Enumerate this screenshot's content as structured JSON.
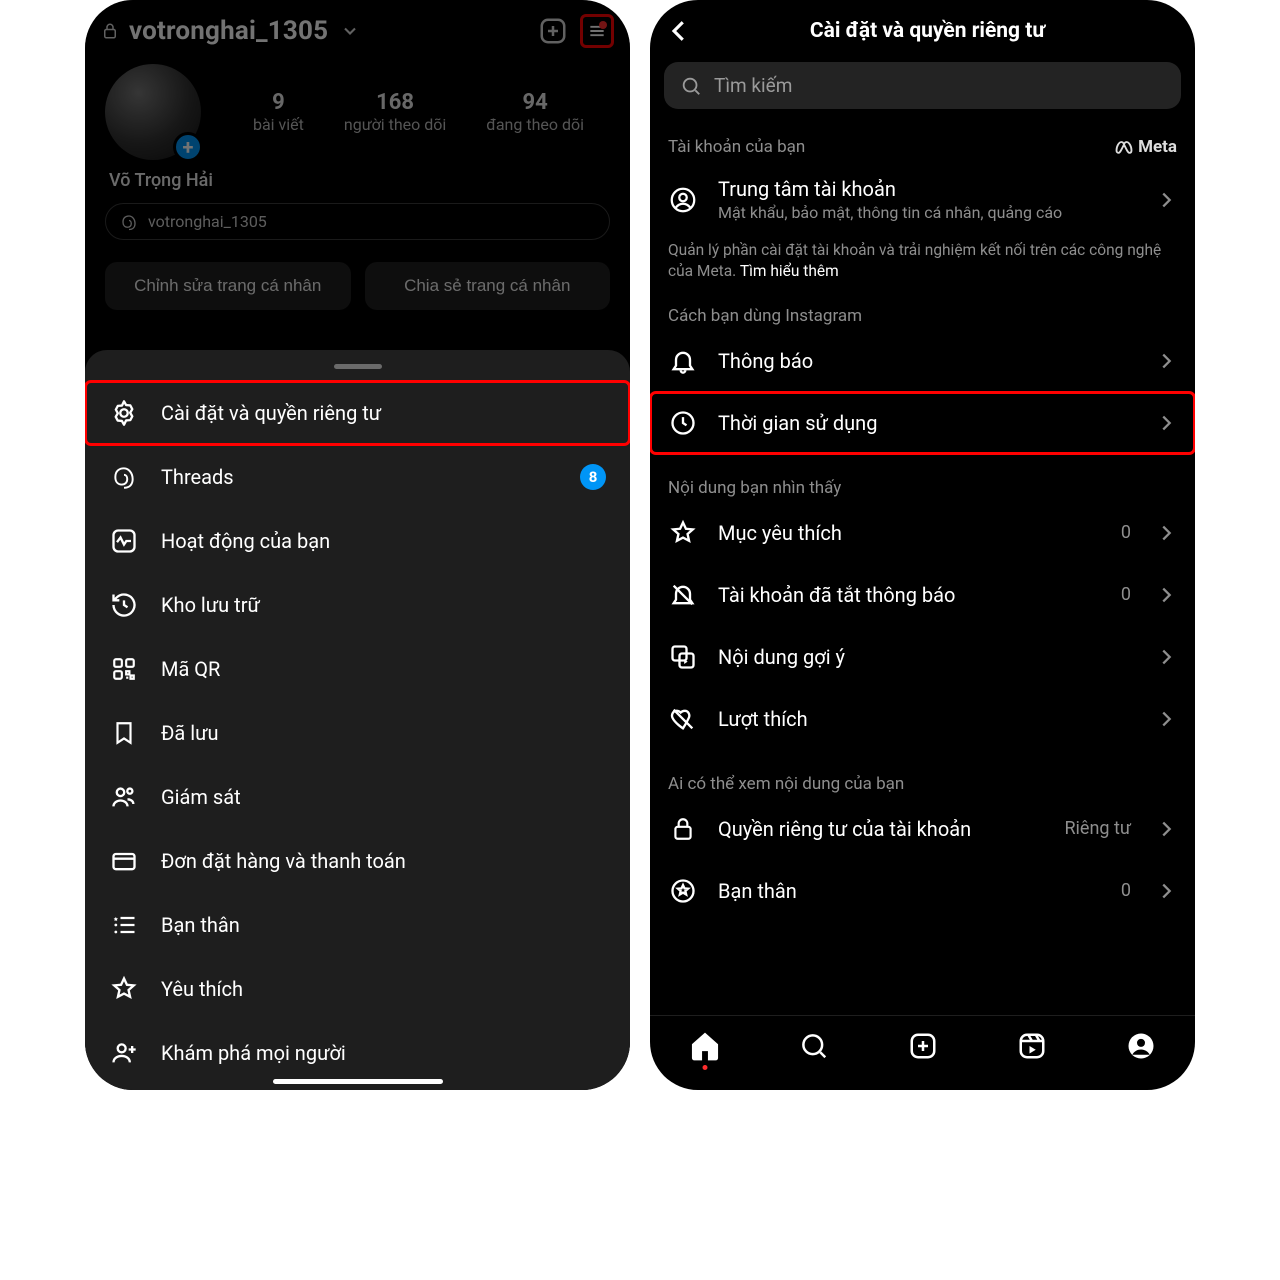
{
  "left": {
    "username": "votronghai_1305",
    "display_name": "Võ Trọng Hải",
    "threads_handle": "votronghai_1305",
    "stats": {
      "posts": {
        "num": "9",
        "label": "bài viết"
      },
      "followers": {
        "num": "168",
        "label": "người theo dõi"
      },
      "following": {
        "num": "94",
        "label": "đang theo dõi"
      }
    },
    "buttons": {
      "edit": "Chỉnh sửa trang cá nhân",
      "share": "Chia sẻ trang cá nhân"
    },
    "sheet": {
      "items": [
        {
          "label": "Cài đặt và quyền riêng tư",
          "highlight": true
        },
        {
          "label": "Threads",
          "badge": "8"
        },
        {
          "label": "Hoạt động của bạn"
        },
        {
          "label": "Kho lưu trữ"
        },
        {
          "label": "Mã QR"
        },
        {
          "label": "Đã lưu"
        },
        {
          "label": "Giám sát"
        },
        {
          "label": "Đơn đặt hàng và thanh toán"
        },
        {
          "label": "Bạn thân"
        },
        {
          "label": "Yêu thích"
        },
        {
          "label": "Khám phá mọi người"
        }
      ]
    }
  },
  "right": {
    "title": "Cài đặt và quyền riêng tư",
    "search_placeholder": "Tìm kiếm",
    "section_account": "Tài khoản của bạn",
    "meta_label": "Meta",
    "account_center": {
      "title": "Trung tâm tài khoản",
      "sub": "Mật khẩu, bảo mật, thông tin cá nhân, quảng cáo"
    },
    "account_desc": "Quản lý phần cài đặt tài khoản và trải nghiệm kết nối trên các công nghệ của Meta.",
    "account_desc_more": "Tìm hiểu thêm",
    "section_usage": "Cách bạn dùng Instagram",
    "rows_usage": [
      {
        "label": "Thông báo"
      },
      {
        "label": "Thời gian sử dụng",
        "highlight": true
      }
    ],
    "section_content": "Nội dung bạn nhìn thấy",
    "rows_content": [
      {
        "label": "Mục yêu thích",
        "side": "0"
      },
      {
        "label": "Tài khoản đã tắt thông báo",
        "side": "0"
      },
      {
        "label": "Nội dung gợi ý"
      },
      {
        "label": "Lượt thích"
      }
    ],
    "section_privacy": "Ai có thể xem nội dung của bạn",
    "rows_privacy": [
      {
        "label": "Quyền riêng tư của tài khoản",
        "side": "Riêng tư"
      },
      {
        "label": "Bạn thân",
        "side": "0"
      }
    ]
  }
}
